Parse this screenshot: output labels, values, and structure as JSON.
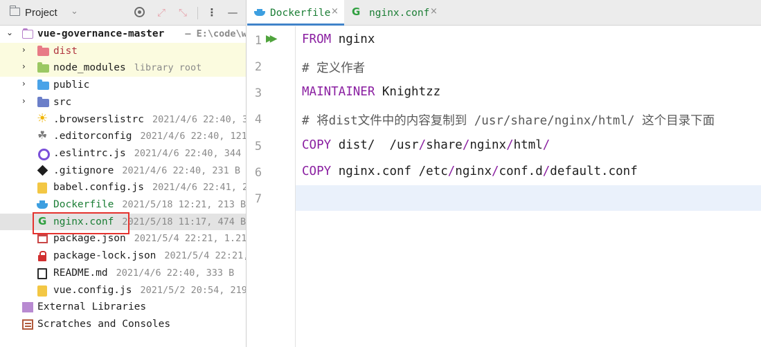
{
  "project": {
    "title": "Project",
    "root": {
      "name": "vue-governance-master",
      "path": "– E:\\code\\wo"
    },
    "folders": [
      {
        "name": "dist",
        "meta": ""
      },
      {
        "name": "node_modules",
        "meta": "library root"
      },
      {
        "name": "public",
        "meta": ""
      },
      {
        "name": "src",
        "meta": ""
      }
    ],
    "files": [
      {
        "name": ".browserslistrc",
        "meta": "2021/4/6 22:40, 30",
        "icon": "browserslist-icon"
      },
      {
        "name": ".editorconfig",
        "meta": "2021/4/6 22:40, 121",
        "icon": "editorconfig-icon"
      },
      {
        "name": ".eslintrc.js",
        "meta": "2021/4/6 22:40, 344 B",
        "icon": "eslint-icon"
      },
      {
        "name": ".gitignore",
        "meta": "2021/4/6 22:40, 231 B",
        "icon": "git-icon"
      },
      {
        "name": "babel.config.js",
        "meta": "2021/4/6 22:41, 21",
        "icon": "js-file-icon"
      },
      {
        "name": "Dockerfile",
        "meta": "2021/5/18 12:21, 213 B",
        "icon": "docker-icon"
      },
      {
        "name": "nginx.conf",
        "meta": "2021/5/18 11:17, 474 B",
        "icon": "nginx-icon"
      },
      {
        "name": "package.json",
        "meta": "2021/5/4 22:21, 1.21",
        "icon": "npm-icon"
      },
      {
        "name": "package-lock.json",
        "meta": "2021/5/4 22:21,",
        "icon": "lock-icon"
      },
      {
        "name": "README.md",
        "meta": "2021/4/6 22:40, 333 B",
        "icon": "markdown-icon"
      },
      {
        "name": "vue.config.js",
        "meta": "2021/5/2 20:54, 219",
        "icon": "js-file-icon"
      }
    ],
    "external_libraries": "External Libraries",
    "scratches": "Scratches and Consoles"
  },
  "editor": {
    "tabs": [
      {
        "label": "Dockerfile",
        "active": true
      },
      {
        "label": "nginx.conf",
        "active": false
      }
    ],
    "line_numbers": [
      "1",
      "2",
      "3",
      "4",
      "5",
      "6",
      "7"
    ],
    "lines": [
      {
        "kw": "FROM",
        "rest": " nginx"
      },
      {
        "comment": "# 定义作者"
      },
      {
        "kw": "MAINTAINER",
        "rest": " Knightzz"
      },
      {
        "comment": "# 将dist文件中的内容复制到 /usr/share/nginx/html/ 这个目录下面"
      },
      {
        "kw": "COPY",
        "a": " dist/  ",
        "p1": "/usr",
        "s1": "/",
        "p2": "share",
        "s2": "/",
        "p3": "nginx",
        "s3": "/",
        "p4": "html",
        "s4": "/"
      },
      {
        "kw": "COPY",
        "a": " nginx.conf ",
        "p1": "/etc",
        "s1": "/",
        "p2": "nginx",
        "s2": "/",
        "p3": "conf.d",
        "s3": "/",
        "p4": "default.conf",
        "s4": ""
      }
    ]
  },
  "colors": {
    "keyword": "#8a1fa1",
    "selection_border": "#e5322e",
    "accent": "#4083c9",
    "vcs_added": "#1b7e35"
  }
}
